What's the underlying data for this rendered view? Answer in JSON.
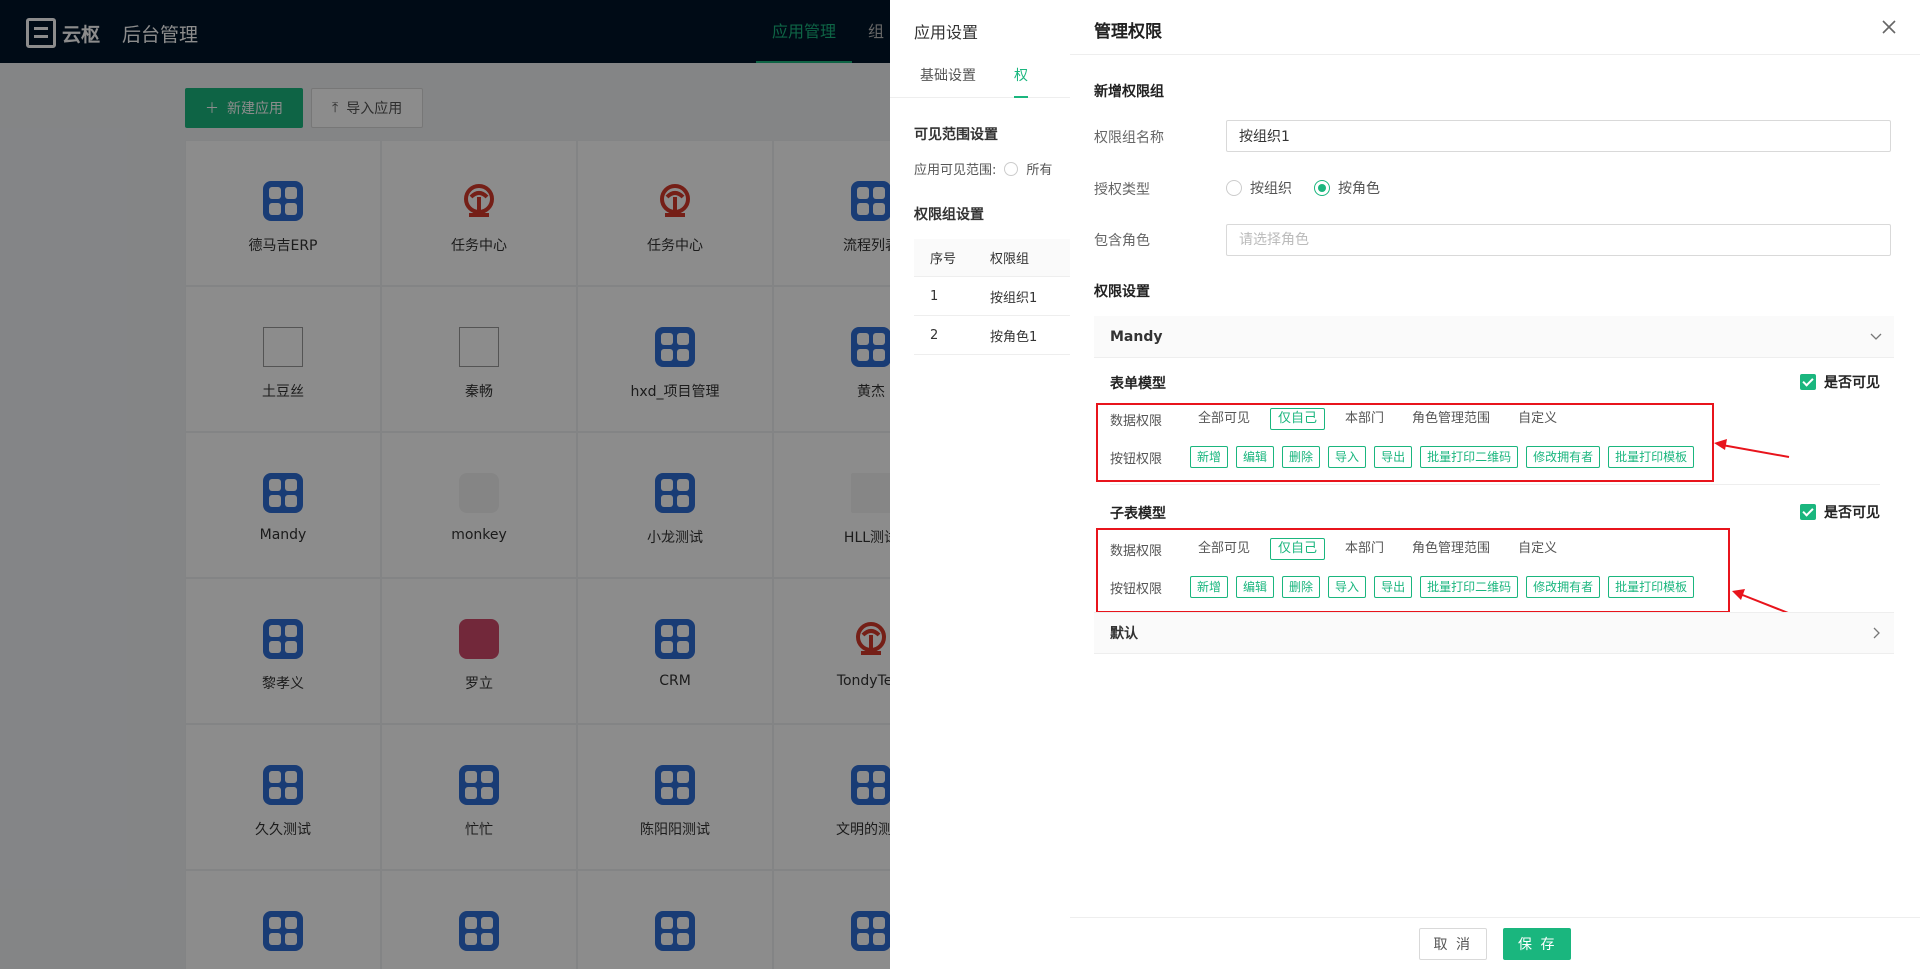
{
  "topbar": {
    "logo_text": "云枢",
    "subtitle": "后台管理",
    "nav": [
      "应用管理",
      "组"
    ]
  },
  "actions": {
    "new_app": "新建应用",
    "import_app": "导入应用"
  },
  "apps": [
    {
      "name": "德马吉ERP",
      "icon": "grid"
    },
    {
      "name": "任务中心",
      "icon": "rail"
    },
    {
      "name": "任务中心",
      "icon": "rail"
    },
    {
      "name": "流程列表",
      "icon": "grid"
    },
    {
      "name": "土豆丝",
      "icon": "broken"
    },
    {
      "name": "秦畅",
      "icon": "broken"
    },
    {
      "name": "hxd_项目管理",
      "icon": "grid"
    },
    {
      "name": "黄杰",
      "icon": "grid"
    },
    {
      "name": "Mandy",
      "icon": "grid"
    },
    {
      "name": "monkey",
      "icon": "monkey"
    },
    {
      "name": "小龙测试",
      "icon": "grid"
    },
    {
      "name": "HLL测试",
      "icon": "doc"
    },
    {
      "name": "黎孝义",
      "icon": "grid"
    },
    {
      "name": "罗立",
      "icon": "pink"
    },
    {
      "name": "CRM",
      "icon": "grid"
    },
    {
      "name": "TondyTest",
      "icon": "rail"
    },
    {
      "name": "久久测试",
      "icon": "grid"
    },
    {
      "name": "忙忙",
      "icon": "grid"
    },
    {
      "name": "陈阳阳测试",
      "icon": "grid"
    },
    {
      "name": "文明的测试",
      "icon": "grid"
    },
    {
      "name": "",
      "icon": "grid"
    },
    {
      "name": "",
      "icon": "grid"
    },
    {
      "name": "",
      "icon": "grid"
    },
    {
      "name": "",
      "icon": "grid"
    }
  ],
  "mid_drawer": {
    "title": "应用设置",
    "tabs": [
      "基础设置",
      "权"
    ],
    "visible_scope_title": "可见范围设置",
    "visible_scope_label": "应用可见范围:",
    "visible_scope_option": "所有",
    "group_title": "权限组设置",
    "table_headers": [
      "序号",
      "权限组"
    ],
    "table_rows": [
      {
        "index": "1",
        "name": "按组织1"
      },
      {
        "index": "2",
        "name": "按角色1"
      }
    ]
  },
  "drawer": {
    "title": "管理权限",
    "new_group_title": "新增权限组",
    "name_label": "权限组名称",
    "name_value": "按组织1",
    "type_label": "授权类型",
    "type_options": [
      "按组织",
      "按角色"
    ],
    "type_selected": "按角色",
    "role_label": "包含角色",
    "role_placeholder": "请选择角色",
    "perm_title": "权限设置",
    "group1": "Mandy",
    "visible_label": "是否可见",
    "models": [
      {
        "title": "表单模型",
        "data_label": "数据权限",
        "data_options": [
          "全部可见",
          "仅自己",
          "本部门",
          "角色管理范围",
          "自定义"
        ],
        "data_selected": "仅自己",
        "btn_label": "按钮权限",
        "btn_tags": [
          "新增",
          "编辑",
          "删除",
          "导入",
          "导出",
          "批量打印二维码",
          "修改拥有者",
          "批量打印模板"
        ]
      },
      {
        "title": "子表模型",
        "data_label": "数据权限",
        "data_options": [
          "全部可见",
          "仅自己",
          "本部门",
          "角色管理范围",
          "自定义"
        ],
        "data_selected": "仅自己",
        "btn_label": "按钮权限",
        "btn_tags": [
          "新增",
          "编辑",
          "删除",
          "导入",
          "导出",
          "批量打印二维码",
          "修改拥有者",
          "批量打印模板"
        ]
      }
    ],
    "group2": "默认",
    "cancel": "取 消",
    "save": "保 存"
  },
  "colors": {
    "accent": "#1ab67e",
    "topbar": "#001529",
    "annotation_red": "#e8141c",
    "app_icon_blue": "#2f6dd5"
  }
}
